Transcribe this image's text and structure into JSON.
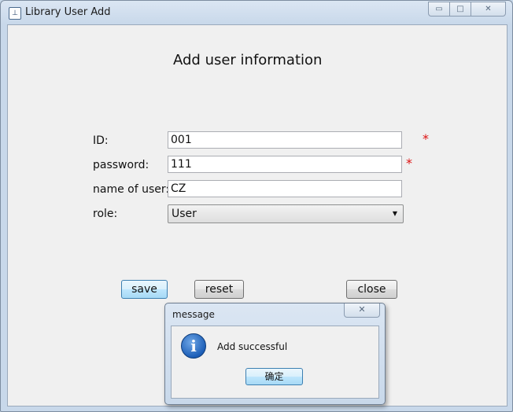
{
  "window": {
    "title": "Library User Add",
    "icon": "app-icon",
    "controls": {
      "minimize": "▭",
      "maximize": "□",
      "close": "✕"
    }
  },
  "form": {
    "heading": "Add user information",
    "fields": [
      {
        "label": "ID:",
        "value": "001",
        "required": true
      },
      {
        "label": "password:",
        "value": "111",
        "required": true
      },
      {
        "label": "name of user:",
        "value": "CZ",
        "required": false
      }
    ],
    "role": {
      "label": "role:",
      "selected": "User"
    },
    "required_mark": "*",
    "buttons": {
      "save": "save",
      "reset": "reset",
      "close": "close"
    }
  },
  "dialog": {
    "title": "message",
    "close_glyph": "✕",
    "icon": "info-icon",
    "message": "Add successful",
    "ok": "确定"
  },
  "colors": {
    "required": "#dd1111",
    "focus_button": "#bee6fd"
  }
}
